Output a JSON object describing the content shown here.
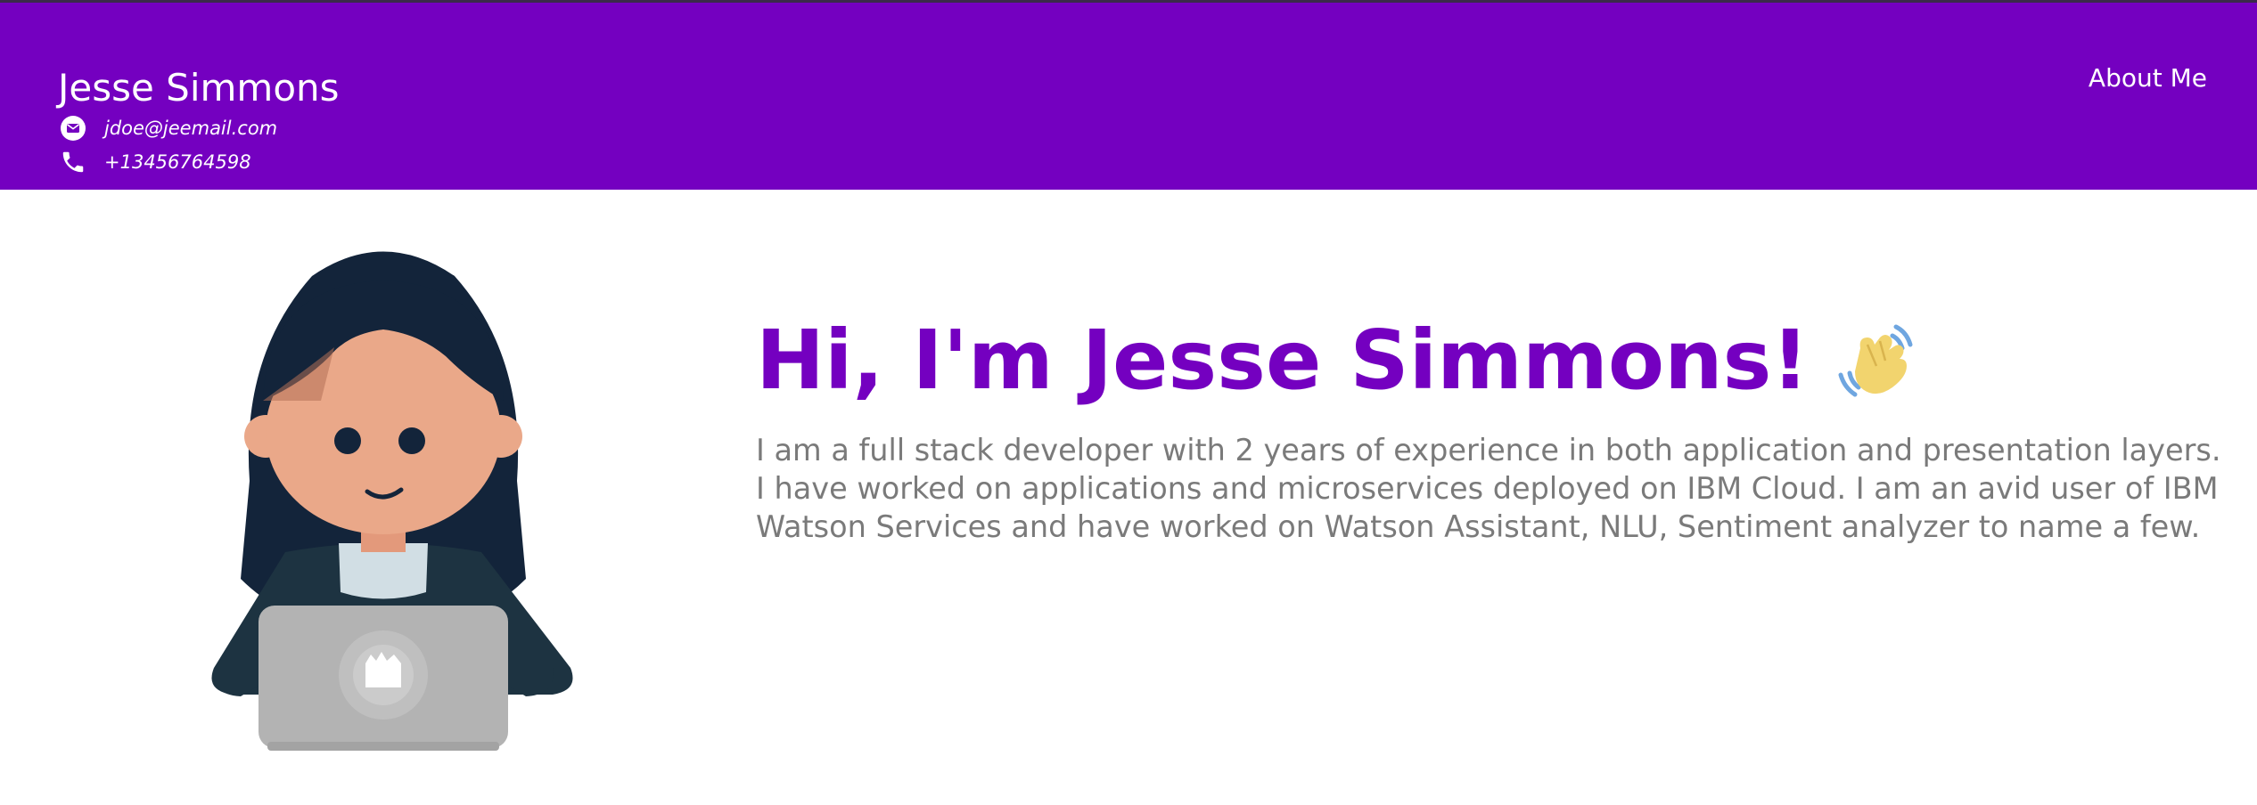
{
  "header": {
    "name": "Jesse Simmons",
    "email": "jdoe@jeemail.com",
    "phone": "+13456764598",
    "nav": [
      {
        "label": "About Me"
      }
    ]
  },
  "hero": {
    "title": "Hi, I'm Jesse Simmons!",
    "paragraph_lines": [
      "I am a full stack developer with 2 years of experience in both application and presentation layers.",
      "I have worked on applications and microservices deployed on IBM Cloud. I am an avid user of IBM",
      "Watson Services and have worked on Watson Assistant, NLU, Sentiment analyzer to name a few."
    ]
  },
  "icons": {
    "email": "envelope-icon",
    "phone": "phone-icon",
    "wave": "waving-hand-icon",
    "avatar": "developer-avatar-illustration"
  },
  "colors": {
    "brand": "#7400c0",
    "text_muted": "#7a7a7a",
    "background": "#ffffff"
  }
}
